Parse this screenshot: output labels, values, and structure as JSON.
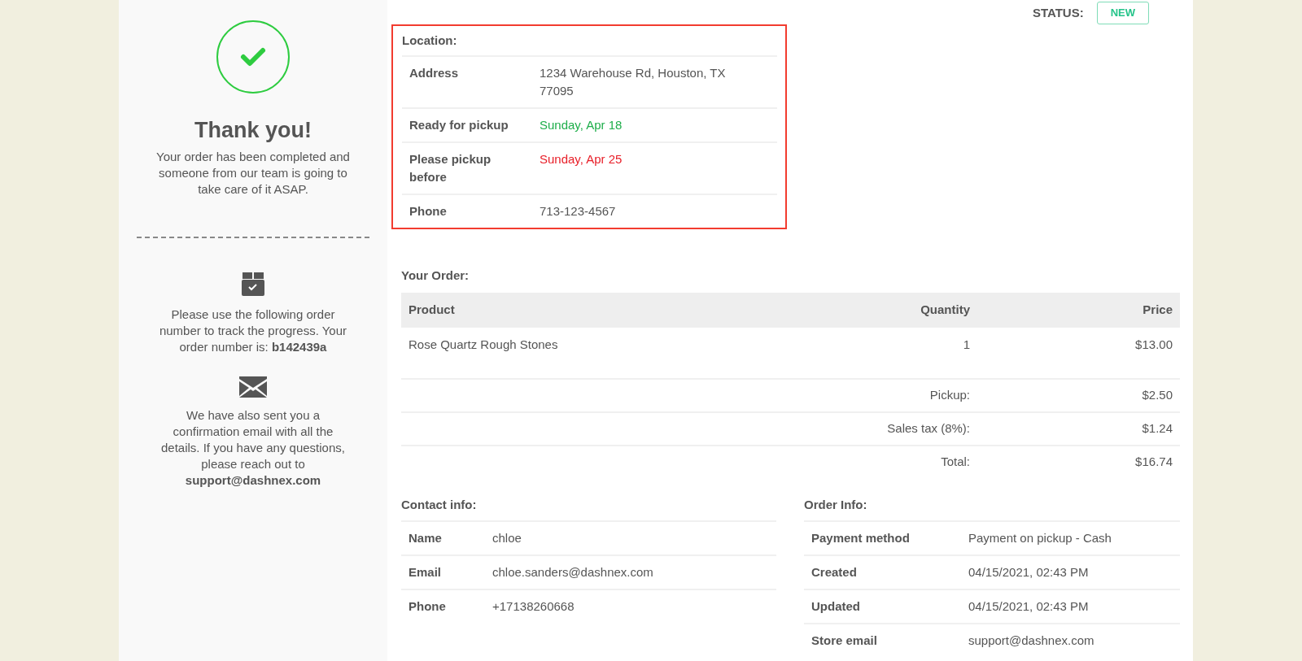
{
  "sidebar": {
    "title": "Thank you!",
    "message": "Your order has been completed and someone from our team is going to take care of it ASAP.",
    "tracking_text": "Please use the following order number to track the progress. Your order number is: **b142439a**",
    "email_text": "We have also sent you a confirmation email with all the details. If you have any questions, please reach out to **support@dashnex.com**"
  },
  "status": {
    "label": "STATUS:",
    "value": "NEW"
  },
  "location": {
    "title": "Location:",
    "highlighted": true,
    "rows": [
      {
        "label": "Address",
        "value": "1234 Warehouse Rd, Houston, TX 77095"
      },
      {
        "label": "Ready for pickup",
        "value": "Sunday, Apr 18",
        "color": "#1fae4b"
      },
      {
        "label": "Please pickup before",
        "value": "Sunday, Apr 25",
        "color": "#e8202a"
      },
      {
        "label": "Phone",
        "value": "713-123-4567"
      }
    ]
  },
  "order": {
    "title": "Your Order:",
    "columns": [
      "Product",
      "Quantity",
      "Price"
    ],
    "rows": [
      {
        "product": "Rose Quartz Rough Stones",
        "quantity": "1",
        "price": "$13.00"
      }
    ],
    "totals": [
      {
        "label": "Pickup:",
        "value": "$2.50"
      },
      {
        "label": "Sales tax (8%):",
        "value": "$1.24"
      },
      {
        "label": "Total:",
        "value": "$16.74"
      }
    ]
  },
  "contact": {
    "title": "Contact info:",
    "rows": [
      {
        "label": "Name",
        "value": "chloe"
      },
      {
        "label": "Email",
        "value": "chloe.sanders@dashnex.com"
      },
      {
        "label": "Phone",
        "value": "+17138260668"
      }
    ]
  },
  "order_info": {
    "title": "Order Info:",
    "rows": [
      {
        "label": "Payment method",
        "value": "Payment on pickup - Cash"
      },
      {
        "label": "Created",
        "value": "04/15/2021, 02:43 PM"
      },
      {
        "label": "Updated",
        "value": "04/15/2021, 02:43 PM"
      },
      {
        "label": "Store email",
        "value": "support@dashnex.com"
      }
    ]
  }
}
